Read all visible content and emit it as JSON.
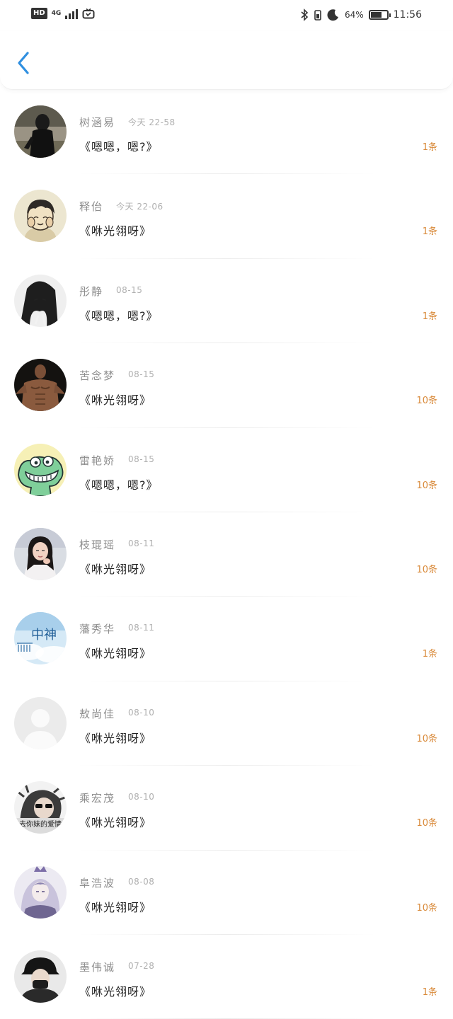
{
  "status_bar": {
    "hd": "HD",
    "network": "4G",
    "battery_percent": "64%",
    "battery_level": 0.64,
    "time": "11:56"
  },
  "header": {
    "back_icon": "chevron-left-icon",
    "accent_color": "#2f8fe0"
  },
  "messages": [
    {
      "name": "树涵易",
      "time": "今天 22-58",
      "text": "《嗯嗯，嗯?》",
      "count": "1条",
      "avatar": "dark-figure"
    },
    {
      "name": "释佁",
      "time": "今天 22-06",
      "text": "《咻光翎呀》",
      "count": "1条",
      "avatar": "cartoon-boy"
    },
    {
      "name": "彤静",
      "time": "08-15",
      "text": "《嗯嗯，嗯?》",
      "count": "1条",
      "avatar": "monochrome-girl"
    },
    {
      "name": "苦念梦",
      "time": "08-15",
      "text": "《咻光翎呀》",
      "count": "10条",
      "avatar": "muscle-man"
    },
    {
      "name": "雷艳娇",
      "time": "08-15",
      "text": "《嗯嗯，嗯?》",
      "count": "10条",
      "avatar": "green-frog"
    },
    {
      "name": "枝琨瑶",
      "time": "08-11",
      "text": "《咻光翎呀》",
      "count": "10条",
      "avatar": "girl-portrait"
    },
    {
      "name": "藩秀华",
      "time": "08-11",
      "text": "《咻光翎呀》",
      "count": "1条",
      "avatar": "sky-text"
    },
    {
      "name": "敖尚佳",
      "time": "08-10",
      "text": "《咻光翎呀》",
      "count": "10条",
      "avatar": "default-avatar"
    },
    {
      "name": "乘宏茂",
      "time": "08-10",
      "text": "《咻光翎呀》",
      "count": "10条",
      "avatar": "sunglasses-boy"
    },
    {
      "name": "阜浩波",
      "time": "08-08",
      "text": "《咻光翎呀》",
      "count": "10条",
      "avatar": "anime-character"
    },
    {
      "name": "墨伟诚",
      "time": "07-28",
      "text": "《咻光翎呀》",
      "count": "1条",
      "avatar": "masked-person"
    }
  ],
  "avatar_overlay_text": "去你妹的爱情",
  "avatar_sky_text": "中神",
  "count_color": "#d98a3a"
}
